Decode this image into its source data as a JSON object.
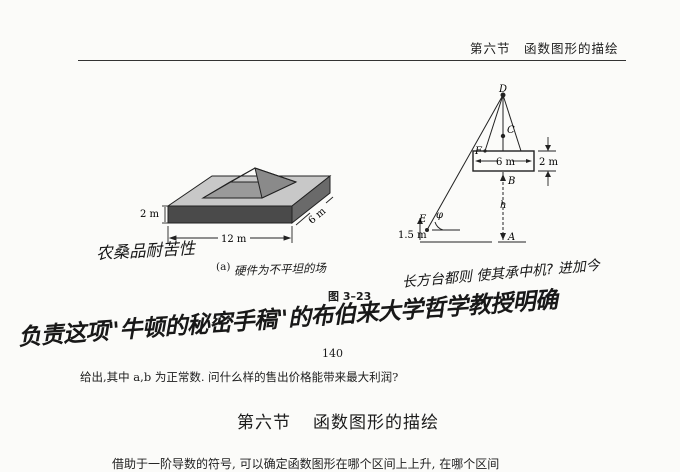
{
  "header": {
    "running_head": "第六节　函数图形的描绘"
  },
  "figure": {
    "label_2m_left": "2 m",
    "label_12m": "12 m",
    "label_6m_left": "6 m",
    "label_D": "D",
    "label_C": "C",
    "label_F": "F",
    "label_6m_right": "6 m",
    "label_2m_right": "2 m",
    "label_B": "B",
    "label_h": "h",
    "label_E": "E",
    "label_phi": "φ",
    "label_15m": "1.5 m",
    "label_A": "A",
    "sub_label_a": "(a)",
    "caption": "图 3–23"
  },
  "page_number": "140",
  "body": {
    "problem_text": "给出,其中 a,b 为正常数. 问什么样的售出价格能带来最大利润?",
    "section_title_num": "第六节",
    "section_title_text": "函数图形的描绘",
    "truncated_line": "借助于一阶导数的符号, 可以确定函数图形在哪个区间上上升, 在哪个区间"
  },
  "handwriting": {
    "line1": "农桑品耐苦性",
    "line2": "硬件为不平坦的场",
    "line3": "长方台都则  使其承中机?  进加今",
    "line4": "负责这项\"牛顿的秘密手稿\"的布伯来大学哲学教授明确"
  }
}
